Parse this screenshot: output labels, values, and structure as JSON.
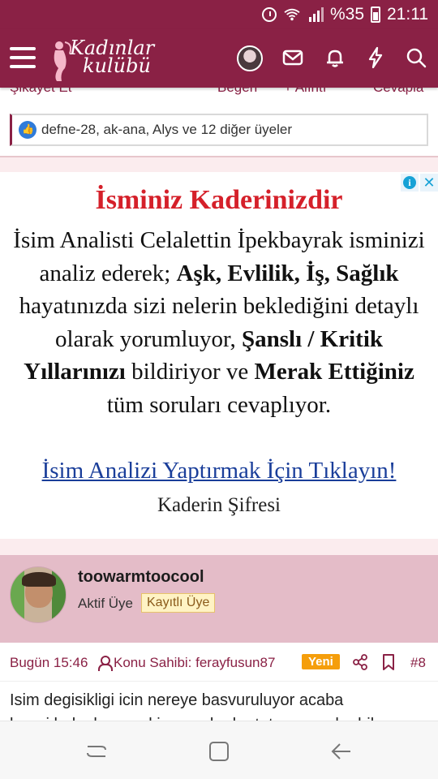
{
  "status_bar": {
    "battery_percent": "%35",
    "time": "21:11"
  },
  "header": {
    "logo_line1": "Kadınlar",
    "logo_line2": "kulübü",
    "icons": [
      "menu-icon",
      "avatar",
      "mail-icon",
      "bell-icon",
      "lightning-icon",
      "search-icon"
    ]
  },
  "action_bar": {
    "report": "Şikayet Et",
    "like": "Beğen",
    "quote": "+ Alıntı",
    "reply": "Cevapla"
  },
  "reactions": {
    "text": "defne-28, ak-ana, Alys ve 12 diğer üyeler"
  },
  "ad": {
    "title": "İsminiz Kaderinizdir",
    "p1": "İsim Analisti Celalettin İpekbayrak isminizi analiz ederek; ",
    "b1": "Aşk, Evlilik, İş, Sağlık",
    "p2": " hayatınızda sizi nelerin beklediğini detaylı olarak yorumluyor, ",
    "b2": "Şanslı / Kritik Yıllarınızı",
    "p3": " bildiriyor ve ",
    "b3": "Merak Ettiğiniz",
    "p4": " tüm soruları cevaplıyor.",
    "link": "İsim Analizi Yaptırmak İçin Tıklayın!",
    "brand": "Kaderin Şifresi"
  },
  "post": {
    "username": "toowarmtoocool",
    "user_title": "Aktif Üye",
    "user_badge": "Kayıtlı Üye",
    "time": "Bugün 15:46",
    "owner": "Konu Sahibi: ferayfusun87",
    "new_label": "Yeni",
    "number": "#8",
    "body_line1": "Isim degisikligi icin nereye basvuruluyor acaba",
    "body_line2": "hangi belgeler gerekiyor ne kadar tutuyor acaba bilen"
  },
  "colors": {
    "brand": "#8a2145",
    "ad_title": "#d5202a",
    "ad_link": "#1a3e9a",
    "user_card_bg": "#e4bcc8",
    "new_badge": "#f59e0b"
  }
}
